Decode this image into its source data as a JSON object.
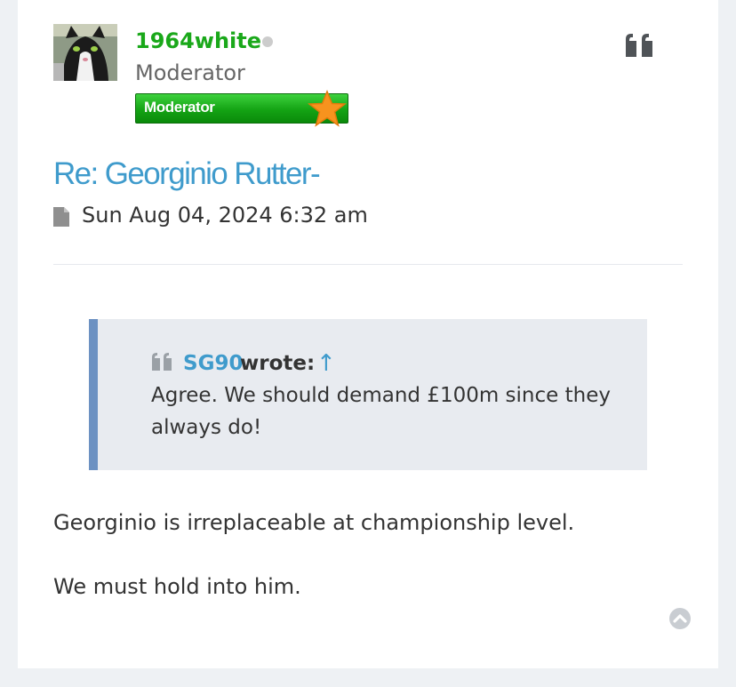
{
  "post": {
    "author": {
      "name": "1964white",
      "rank": "Moderator",
      "rank_badge_label": "Moderator",
      "status": "offline"
    },
    "title": "Re: Georginio Rutter-",
    "date": "Sun Aug 04, 2024 6:32 am",
    "quote": {
      "author": "SG90",
      "wrote_label": "wrote:",
      "jump_icon": "↑",
      "text": "Agree. We should demand £100m since they always do!"
    },
    "body": [
      "Georginio is irreplaceable at championship level.",
      "We must hold into him."
    ]
  },
  "icons": {
    "quote_button": "quote-icon",
    "post_file": "file-icon",
    "back_to_top": "chevron-up-circle-icon"
  },
  "colors": {
    "author_name": "#1aa81a",
    "link": "#3f9bcc",
    "quote_bar": "#6c91c2",
    "quote_bg": "#e8ebf0",
    "badge_green": "#14a314",
    "badge_star": "#f7931e"
  }
}
